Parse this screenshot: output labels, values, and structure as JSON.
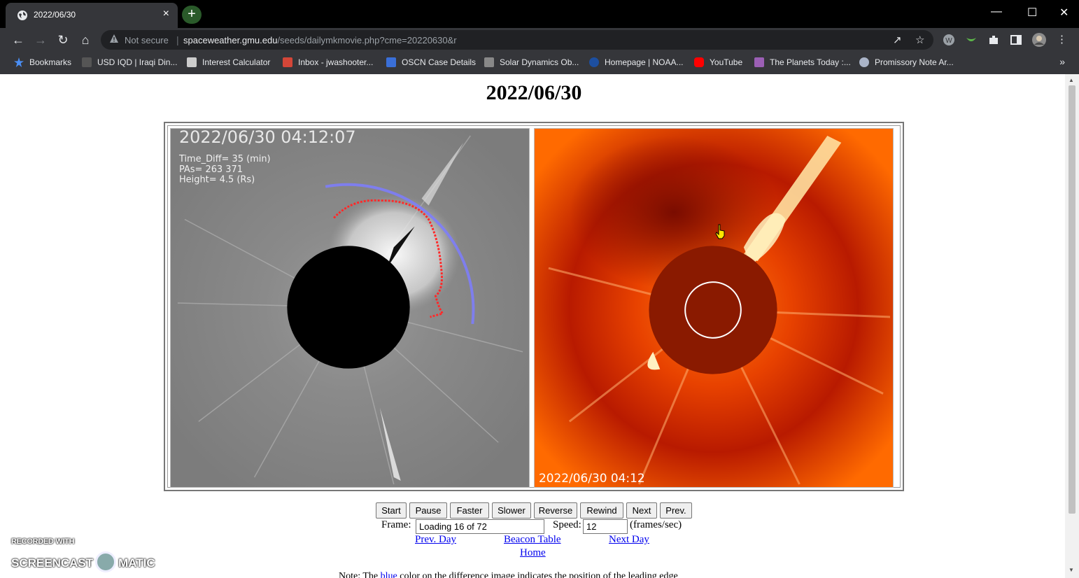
{
  "tab": {
    "title": "2022/06/30",
    "close": "×",
    "new_tab": "+"
  },
  "window": {
    "minimize": "—",
    "maximize": "☐",
    "close": "✕"
  },
  "address_bar": {
    "security": "Not secure",
    "separator": "|",
    "domain": "spaceweather.gmu.edu",
    "path": "/seeds/dailymkmovie.php?cme=20220630&r"
  },
  "bookmarks": [
    {
      "label": "Bookmarks",
      "icon": "star-icon",
      "color": "#4a8ef5"
    },
    {
      "label": "USD IQD | Iraqi Din...",
      "icon": "inv-icon",
      "color": "#555555"
    },
    {
      "label": "Interest Calculator",
      "icon": "calculator-icon",
      "color": "#cccccc"
    },
    {
      "label": "Inbox - jwashooter...",
      "icon": "gmail-icon",
      "color": "#d44638"
    },
    {
      "label": "OSCN Case Details",
      "icon": "oscn-icon",
      "color": "#3a6fd8"
    },
    {
      "label": "Solar Dynamics Ob...",
      "icon": "sdo-icon",
      "color": "#888888"
    },
    {
      "label": "Homepage | NOAA...",
      "icon": "noaa-icon",
      "color": "#1d4fa0"
    },
    {
      "label": "YouTube",
      "icon": "youtube-icon",
      "color": "#ff0000"
    },
    {
      "label": "The Planets Today :...",
      "icon": "planets-icon",
      "color": "#9b5fb5"
    },
    {
      "label": "Promissory Note Ar...",
      "icon": "note-icon",
      "color": "#aab4c8"
    }
  ],
  "bookmarks_more": "»",
  "page": {
    "title": "2022/06/30",
    "left_image": {
      "timestamp": "2022/06/30  04:12:07",
      "time_diff": "Time_Diff=  35  (min)",
      "pas": "PAs=   263  371",
      "height": "Height=   4.5  (Rs)"
    },
    "right_image": {
      "timestamp": "2022/06/30 04:12"
    },
    "buttons": {
      "start": "Start",
      "pause": "Pause",
      "faster": "Faster",
      "slower": "Slower",
      "reverse": "Reverse",
      "rewind": "Rewind",
      "next": "Next",
      "prev": "Prev."
    },
    "frame_label": "Frame:",
    "frame_value": "Loading 16 of 72",
    "speed_label": "Speed:",
    "speed_value": "12",
    "speed_unit": "(frames/sec)",
    "links": {
      "prev_day": "Prev. Day ",
      "beacon_table": "Beacon Table",
      "next_day": "Next Day",
      "home": "Home"
    },
    "note": {
      "prefix": "Note: The ",
      "blue": "blue",
      "suffix": " color on the difference image indicates the position of the leading edge"
    }
  },
  "watermark": {
    "line1": "RECORDED WITH",
    "left": "SCREENCAST",
    "right": "MATIC"
  },
  "colors": {
    "chrome_bg": "#35363a",
    "link": "#0000ee",
    "lasco_orange": "#ff6a00"
  }
}
